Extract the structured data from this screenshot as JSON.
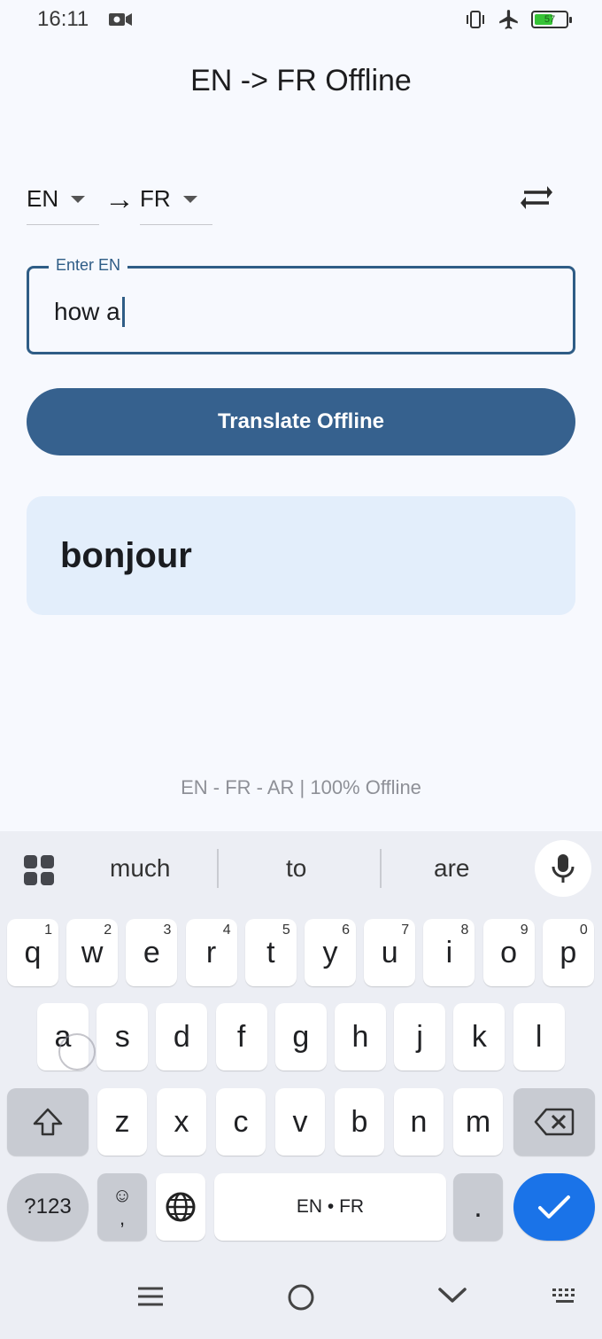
{
  "status": {
    "time": "16:11",
    "battery_level": "57",
    "icons": [
      "video-record-icon",
      "vibrate-icon",
      "airplane-icon",
      "battery-charging-icon"
    ]
  },
  "app": {
    "title": "EN -> FR Offline"
  },
  "languages": {
    "from": "EN",
    "to": "FR",
    "arrow": "→"
  },
  "input": {
    "label": "Enter EN",
    "value": "how a"
  },
  "actions": {
    "translate_label": "Translate Offline"
  },
  "result": {
    "text": "bonjour"
  },
  "footer": {
    "note": "EN - FR - AR | 100% Offline"
  },
  "keyboard": {
    "suggestions": [
      "much",
      "to",
      "are"
    ],
    "row1": [
      {
        "key": "q",
        "hint": "1"
      },
      {
        "key": "w",
        "hint": "2"
      },
      {
        "key": "e",
        "hint": "3"
      },
      {
        "key": "r",
        "hint": "4"
      },
      {
        "key": "t",
        "hint": "5"
      },
      {
        "key": "y",
        "hint": "6"
      },
      {
        "key": "u",
        "hint": "7"
      },
      {
        "key": "i",
        "hint": "8"
      },
      {
        "key": "o",
        "hint": "9"
      },
      {
        "key": "p",
        "hint": "0"
      }
    ],
    "row2": [
      "a",
      "s",
      "d",
      "f",
      "g",
      "h",
      "j",
      "k",
      "l"
    ],
    "row3": [
      "z",
      "x",
      "c",
      "v",
      "b",
      "n",
      "m"
    ],
    "symbols_label": "?123",
    "emoji_key": "☺",
    "comma_key": ",",
    "space_label": "EN • FR",
    "period_key": "."
  },
  "colors": {
    "primary": "#36618e",
    "outline": "#2f5d86",
    "result_bg": "#e3eefb",
    "enter_key": "#1a73e8"
  }
}
